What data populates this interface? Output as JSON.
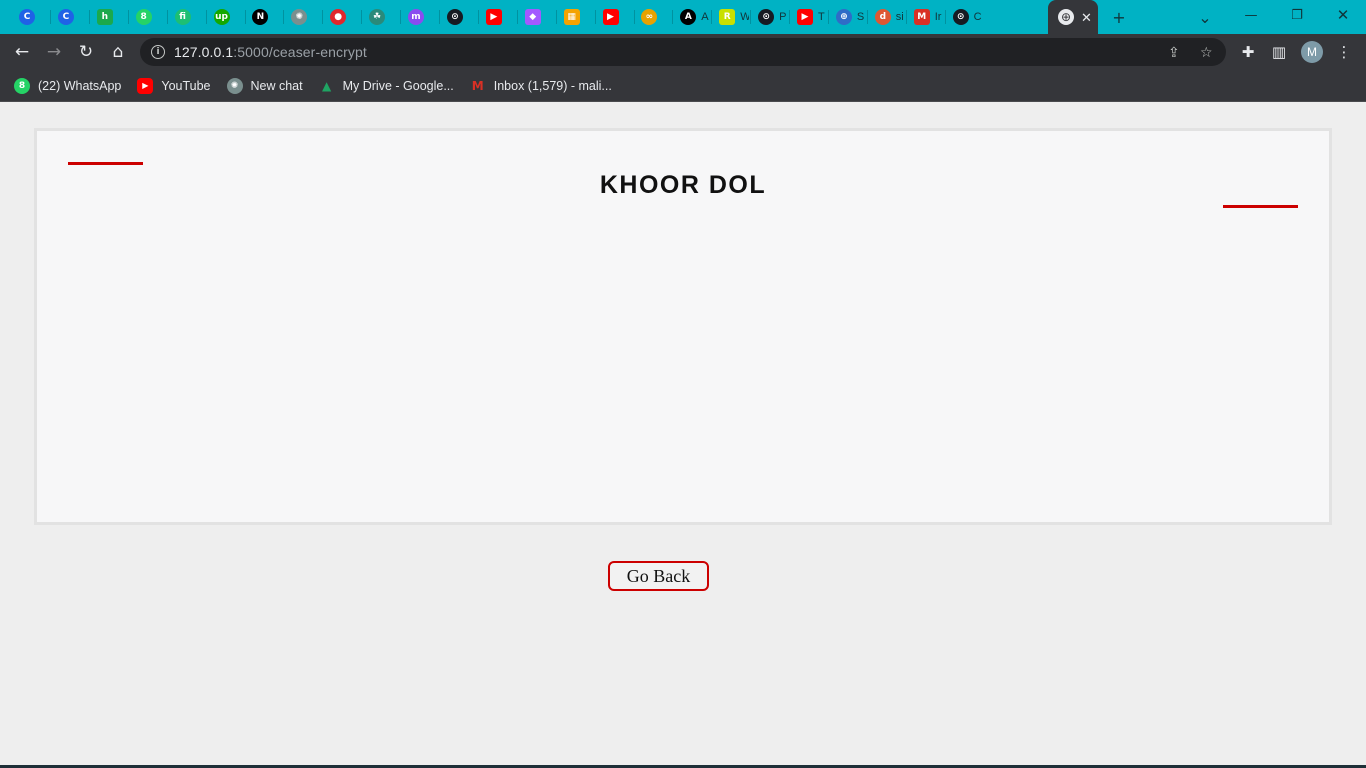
{
  "browser": {
    "tabs": [
      {
        "icon": "coursera-icon",
        "glyph": "C",
        "color": "#1f62e6",
        "title": "",
        "shape": "circle"
      },
      {
        "icon": "coursera-icon",
        "glyph": "C",
        "color": "#1f62e6",
        "title": "",
        "shape": "circle"
      },
      {
        "icon": "hackerrank-icon",
        "glyph": "h",
        "color": "#1ba94c",
        "title": "",
        "shape": "sq"
      },
      {
        "icon": "whatsapp-icon",
        "glyph": "8",
        "color": "#25d366",
        "title": "",
        "shape": "circle"
      },
      {
        "icon": "fiverr-icon",
        "glyph": "fi",
        "color": "#1dbf73",
        "title": "",
        "shape": "circle"
      },
      {
        "icon": "upwork-icon",
        "glyph": "up",
        "color": "#14a800",
        "title": "",
        "shape": "circle"
      },
      {
        "icon": "nextjs-icon",
        "glyph": "N",
        "color": "#000000",
        "title": "",
        "shape": "circle"
      },
      {
        "icon": "chatgpt-icon",
        "glyph": "✺",
        "color": "#7a8f8e",
        "title": "",
        "shape": "circle"
      },
      {
        "icon": "record-icon",
        "glyph": "●",
        "color": "#e0262c",
        "title": "",
        "shape": "circle"
      },
      {
        "icon": "bot-icon",
        "glyph": "☘",
        "color": "#2a8a7a",
        "title": "",
        "shape": "circle"
      },
      {
        "icon": "messenger-icon",
        "glyph": "m",
        "color": "#8a4cf0",
        "title": "",
        "shape": "circle"
      },
      {
        "icon": "github-icon",
        "glyph": "⊙",
        "color": "#161b22",
        "title": "",
        "shape": "circle"
      },
      {
        "icon": "youtube-icon",
        "glyph": "▶",
        "color": "#ff0000",
        "title": "",
        "shape": "sq"
      },
      {
        "icon": "figma-icon",
        "glyph": "◆",
        "color": "#a259ff",
        "title": "",
        "shape": "sq"
      },
      {
        "icon": "colorful-icon",
        "glyph": "▦",
        "color": "#f4a300",
        "title": "",
        "shape": "sq"
      },
      {
        "icon": "youtube-icon",
        "glyph": "▶",
        "color": "#ff0000",
        "title": "",
        "shape": "sq"
      },
      {
        "icon": "infinity-icon",
        "glyph": "∞",
        "color": "#e8a200",
        "title": "",
        "shape": "circle"
      },
      {
        "icon": "app-icon",
        "glyph": "A",
        "color": "#000000",
        "title": "A",
        "shape": "circle"
      },
      {
        "icon": "readit-icon",
        "glyph": "R",
        "color": "#c8e000",
        "title": "W",
        "shape": "sq"
      },
      {
        "icon": "github-icon",
        "glyph": "⊙",
        "color": "#161b22",
        "title": "P",
        "shape": "circle"
      },
      {
        "icon": "youtube-icon",
        "glyph": "▶",
        "color": "#ff0000",
        "title": "T",
        "shape": "sq"
      },
      {
        "icon": "globe-icon",
        "glyph": "⊕",
        "color": "#2f6cc7",
        "title": "S",
        "shape": "circle"
      },
      {
        "icon": "duckduckgo-icon",
        "glyph": "d",
        "color": "#de5833",
        "title": "si",
        "shape": "circle"
      },
      {
        "icon": "gmail-icon",
        "glyph": "M",
        "color": "#d93025",
        "title": "Ir",
        "shape": "sq"
      },
      {
        "icon": "github-icon",
        "glyph": "⊙",
        "color": "#161b22",
        "title": "C",
        "shape": "circle"
      }
    ],
    "active_tab": {
      "icon": "globe-icon",
      "glyph": "⊕",
      "close_glyph": "✕"
    },
    "new_tab_glyph": "+",
    "tab_search_glyph": "⌄",
    "window_controls": {
      "minimize": "—",
      "restore": "❐",
      "close": "✕"
    },
    "nav": {
      "back": "←",
      "forward": "→",
      "reload": "↻",
      "home": "⌂"
    },
    "address": {
      "info_glyph": "i",
      "host": "127.0.0.1",
      "path": ":5000/ceaser-encrypt"
    },
    "toolbar_icons": {
      "share": "⇪",
      "bookmark_star": "☆",
      "extensions": "✚",
      "side_panel": "▥",
      "menu": "⋮"
    },
    "profile_initial": "M",
    "bookmarks": [
      {
        "icon": "whatsapp-icon",
        "glyph": "8",
        "color": "#25d366",
        "label": "(22) WhatsApp"
      },
      {
        "icon": "youtube-icon",
        "glyph": "▶",
        "color": "#ff0000",
        "label": "YouTube"
      },
      {
        "icon": "chatgpt-icon",
        "glyph": "✺",
        "color": "#7a8f8e",
        "label": "New chat"
      },
      {
        "icon": "google-drive-icon",
        "glyph": "▲",
        "color": "#1fa463",
        "label": "My Drive - Google..."
      },
      {
        "icon": "gmail-icon",
        "glyph": "M",
        "color": "#d93025",
        "label": "Inbox (1,579) - mali..."
      }
    ]
  },
  "page": {
    "result_text": "KHOOR DOL",
    "go_back_label": "Go Back",
    "accent_color": "#cc0000"
  }
}
